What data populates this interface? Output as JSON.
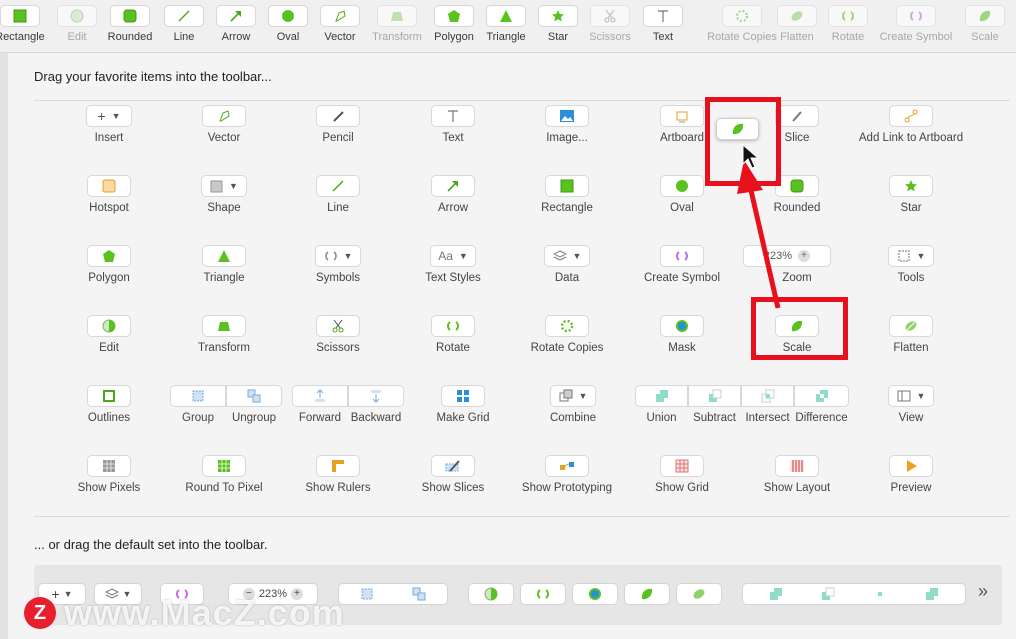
{
  "colors": {
    "accent": "#5ac220",
    "highlight": "#e8101c",
    "purple": "#c070e0"
  },
  "toolbar": {
    "items": [
      {
        "label": "Rectangle",
        "icon": "rectangle-icon",
        "disabled": false
      },
      {
        "label": "Edit",
        "icon": "edit-icon",
        "disabled": true
      },
      {
        "label": "Rounded",
        "icon": "rounded-rect-icon",
        "disabled": false
      },
      {
        "label": "Line",
        "icon": "line-icon",
        "disabled": false
      },
      {
        "label": "Arrow",
        "icon": "arrow-icon",
        "disabled": false
      },
      {
        "label": "Oval",
        "icon": "oval-icon",
        "disabled": false
      },
      {
        "label": "Vector",
        "icon": "vector-icon",
        "disabled": false
      },
      {
        "label": "Transform",
        "icon": "transform-icon",
        "disabled": true
      },
      {
        "label": "Polygon",
        "icon": "polygon-icon",
        "disabled": false
      },
      {
        "label": "Triangle",
        "icon": "triangle-icon",
        "disabled": false
      },
      {
        "label": "Star",
        "icon": "star-icon",
        "disabled": false
      },
      {
        "label": "Scissors",
        "icon": "scissors-icon",
        "disabled": true
      },
      {
        "label": "Text",
        "icon": "text-icon",
        "disabled": false
      },
      {
        "label": "Rotate Copies",
        "icon": "rotate-copies-icon",
        "disabled": true
      },
      {
        "label": "Flatten",
        "icon": "flatten-icon",
        "disabled": true
      },
      {
        "label": "Rotate",
        "icon": "rotate-icon",
        "disabled": true
      },
      {
        "label": "Create Symbol",
        "icon": "create-symbol-icon",
        "disabled": true
      },
      {
        "label": "Scale",
        "icon": "scale-icon",
        "disabled": true
      }
    ]
  },
  "sheet": {
    "title": "Drag your favorite items into the toolbar...",
    "default_title": "... or drag the default set into the toolbar.",
    "zoom_value": "223%",
    "rows": [
      [
        {
          "label": "Insert",
          "icon": "plus-icon"
        },
        {
          "label": "Vector",
          "icon": "vector-icon"
        },
        {
          "label": "Pencil",
          "icon": "pencil-icon"
        },
        {
          "label": "Text",
          "icon": "text-icon"
        },
        {
          "label": "Image...",
          "icon": "image-icon"
        },
        {
          "label": "Artboard",
          "icon": "artboard-icon"
        },
        {
          "label": "Slice",
          "icon": "slice-icon"
        },
        {
          "label": "Add Link to Artboard",
          "icon": "link-icon"
        }
      ],
      [
        {
          "label": "Hotspot",
          "icon": "hotspot-icon"
        },
        {
          "label": "Shape",
          "icon": "shape-icon"
        },
        {
          "label": "Line",
          "icon": "line-icon"
        },
        {
          "label": "Arrow",
          "icon": "arrow-icon"
        },
        {
          "label": "Rectangle",
          "icon": "rectangle-icon"
        },
        {
          "label": "Oval",
          "icon": "oval-icon"
        },
        {
          "label": "Rounded",
          "icon": "rounded-rect-icon"
        },
        {
          "label": "Star",
          "icon": "star-icon"
        }
      ],
      [
        {
          "label": "Polygon",
          "icon": "polygon-icon"
        },
        {
          "label": "Triangle",
          "icon": "triangle-icon"
        },
        {
          "label": "Symbols",
          "icon": "symbols-icon"
        },
        {
          "label": "Text Styles",
          "icon": "text-styles-icon"
        },
        {
          "label": "Data",
          "icon": "data-icon"
        },
        {
          "label": "Create Symbol",
          "icon": "create-symbol-icon"
        },
        {
          "label": "Zoom",
          "icon": "zoom-icon"
        },
        {
          "label": "Tools",
          "icon": "tools-icon"
        }
      ],
      [
        {
          "label": "Edit",
          "icon": "edit-icon"
        },
        {
          "label": "Transform",
          "icon": "transform-icon"
        },
        {
          "label": "Scissors",
          "icon": "scissors-icon"
        },
        {
          "label": "Rotate",
          "icon": "rotate-icon"
        },
        {
          "label": "Rotate Copies",
          "icon": "rotate-copies-icon"
        },
        {
          "label": "Mask",
          "icon": "mask-icon"
        },
        {
          "label": "Scale",
          "icon": "scale-icon"
        },
        {
          "label": "Flatten",
          "icon": "flatten-icon"
        }
      ],
      [
        {
          "label": "Outlines",
          "icon": "outlines-icon"
        },
        {
          "label": "Group",
          "icon": "group-icon"
        },
        {
          "label": "Ungroup",
          "icon": "ungroup-icon"
        },
        {
          "label": "Forward",
          "icon": "forward-icon"
        },
        {
          "label": "Backward",
          "icon": "backward-icon"
        },
        {
          "label": "Make Grid",
          "icon": "make-grid-icon"
        },
        {
          "label": "Combine",
          "icon": "combine-icon"
        },
        {
          "label": "Union",
          "icon": "union-icon"
        },
        {
          "label": "Subtract",
          "icon": "subtract-icon"
        },
        {
          "label": "Intersect",
          "icon": "intersect-icon"
        },
        {
          "label": "Difference",
          "icon": "difference-icon"
        },
        {
          "label": "View",
          "icon": "view-icon"
        }
      ],
      [
        {
          "label": "Show Pixels",
          "icon": "show-pixels-icon"
        },
        {
          "label": "Round To Pixel",
          "icon": "round-to-pixel-icon"
        },
        {
          "label": "Show Rulers",
          "icon": "show-rulers-icon"
        },
        {
          "label": "Show Slices",
          "icon": "show-slices-icon"
        },
        {
          "label": "Show Prototyping",
          "icon": "show-prototyping-icon"
        },
        {
          "label": "Show Grid",
          "icon": "show-grid-icon"
        },
        {
          "label": "Show Layout",
          "icon": "show-layout-icon"
        },
        {
          "label": "Preview",
          "icon": "preview-icon"
        }
      ]
    ]
  },
  "watermark": {
    "logo": "Z",
    "text": "www.MacZ.com"
  },
  "overflow_label": "»"
}
